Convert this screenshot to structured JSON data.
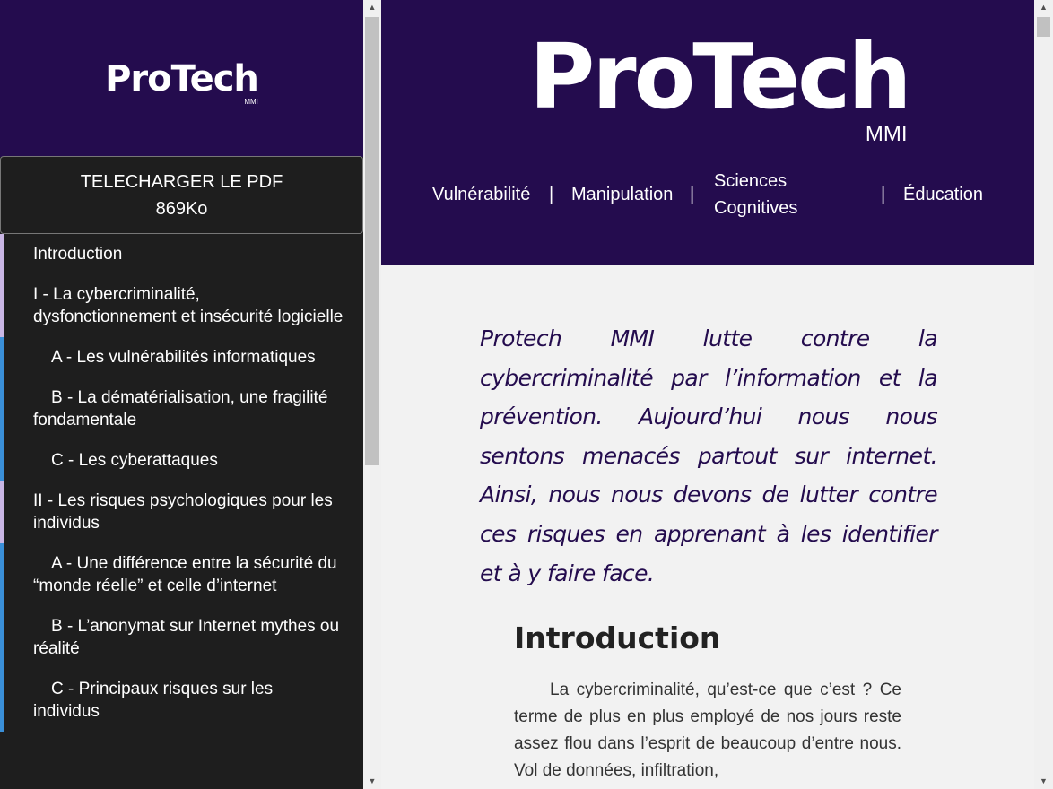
{
  "sidebar": {
    "logo": {
      "name": "ProTech",
      "sub": "MMI"
    },
    "pdf_button": {
      "label": "TELECHARGER LE PDF",
      "size": "869Ko"
    },
    "toc": [
      {
        "label": "Introduction",
        "level": "section"
      },
      {
        "label": "I - La cybercriminalité, dysfonctionnement et insécurité logicielle",
        "level": "section"
      },
      {
        "label": "A - Les vulnérabilités informatiques",
        "level": "sub"
      },
      {
        "label": "B - La dématérialisation, une fragilité fondamentale",
        "level": "sub"
      },
      {
        "label": "C - Les cyberattaques",
        "level": "sub"
      },
      {
        "label": "II - Les risques psychologiques pour les individus",
        "level": "section"
      },
      {
        "label": "A - Une différence entre la sécurité du “monde réelle” et celle d’internet",
        "level": "sub"
      },
      {
        "label": "B - L’anonymat sur Internet mythes ou réalité",
        "level": "sub"
      },
      {
        "label": "C - Principaux risques sur les individus",
        "level": "sub"
      }
    ]
  },
  "header": {
    "logo": {
      "name": "ProTech",
      "sub": "MMI"
    },
    "nav": {
      "vulnerabilite": "Vulnérabilité",
      "manipulation": "Manipulation",
      "sciences_line1": "Sciences",
      "sciences_line2": "Cognitives",
      "education": "Éducation",
      "separator": "|"
    }
  },
  "main": {
    "intro_quote": "Protech MMI lutte contre la cybercriminalité par l’information et la prévention. Aujourd’hui nous nous sentons menacés partout sur internet. Ainsi, nous nous devons de lutter contre ces risques en apprenant à les identifier et à y faire face.",
    "section_title": "Introduction",
    "section_body": "La cybercriminalité, qu’est-ce que c’est ? Ce terme de plus en plus employé de nos jours reste assez flou dans l’esprit de beaucoup d’entre nous. Vol de données, infiltration,"
  },
  "colors": {
    "brand_purple": "#240c4e",
    "sidebar_bg": "#1e1e1e",
    "section_bar": "#c9b6e4",
    "subsection_bar": "#3a8fd8"
  },
  "icons": {
    "scroll_up": "▲",
    "scroll_down": "▼"
  }
}
